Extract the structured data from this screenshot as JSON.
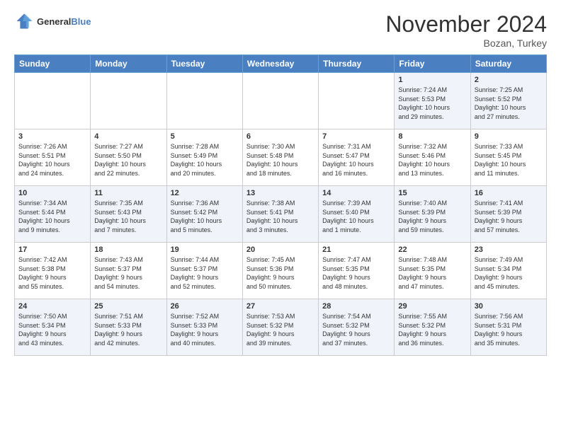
{
  "header": {
    "logo_line1": "General",
    "logo_line2": "Blue",
    "month_title": "November 2024",
    "location": "Bozan, Turkey"
  },
  "days_of_week": [
    "Sunday",
    "Monday",
    "Tuesday",
    "Wednesday",
    "Thursday",
    "Friday",
    "Saturday"
  ],
  "weeks": [
    [
      {
        "day": "",
        "detail": ""
      },
      {
        "day": "",
        "detail": ""
      },
      {
        "day": "",
        "detail": ""
      },
      {
        "day": "",
        "detail": ""
      },
      {
        "day": "",
        "detail": ""
      },
      {
        "day": "1",
        "detail": "Sunrise: 7:24 AM\nSunset: 5:53 PM\nDaylight: 10 hours\nand 29 minutes."
      },
      {
        "day": "2",
        "detail": "Sunrise: 7:25 AM\nSunset: 5:52 PM\nDaylight: 10 hours\nand 27 minutes."
      }
    ],
    [
      {
        "day": "3",
        "detail": "Sunrise: 7:26 AM\nSunset: 5:51 PM\nDaylight: 10 hours\nand 24 minutes."
      },
      {
        "day": "4",
        "detail": "Sunrise: 7:27 AM\nSunset: 5:50 PM\nDaylight: 10 hours\nand 22 minutes."
      },
      {
        "day": "5",
        "detail": "Sunrise: 7:28 AM\nSunset: 5:49 PM\nDaylight: 10 hours\nand 20 minutes."
      },
      {
        "day": "6",
        "detail": "Sunrise: 7:30 AM\nSunset: 5:48 PM\nDaylight: 10 hours\nand 18 minutes."
      },
      {
        "day": "7",
        "detail": "Sunrise: 7:31 AM\nSunset: 5:47 PM\nDaylight: 10 hours\nand 16 minutes."
      },
      {
        "day": "8",
        "detail": "Sunrise: 7:32 AM\nSunset: 5:46 PM\nDaylight: 10 hours\nand 13 minutes."
      },
      {
        "day": "9",
        "detail": "Sunrise: 7:33 AM\nSunset: 5:45 PM\nDaylight: 10 hours\nand 11 minutes."
      }
    ],
    [
      {
        "day": "10",
        "detail": "Sunrise: 7:34 AM\nSunset: 5:44 PM\nDaylight: 10 hours\nand 9 minutes."
      },
      {
        "day": "11",
        "detail": "Sunrise: 7:35 AM\nSunset: 5:43 PM\nDaylight: 10 hours\nand 7 minutes."
      },
      {
        "day": "12",
        "detail": "Sunrise: 7:36 AM\nSunset: 5:42 PM\nDaylight: 10 hours\nand 5 minutes."
      },
      {
        "day": "13",
        "detail": "Sunrise: 7:38 AM\nSunset: 5:41 PM\nDaylight: 10 hours\nand 3 minutes."
      },
      {
        "day": "14",
        "detail": "Sunrise: 7:39 AM\nSunset: 5:40 PM\nDaylight: 10 hours\nand 1 minute."
      },
      {
        "day": "15",
        "detail": "Sunrise: 7:40 AM\nSunset: 5:39 PM\nDaylight: 9 hours\nand 59 minutes."
      },
      {
        "day": "16",
        "detail": "Sunrise: 7:41 AM\nSunset: 5:39 PM\nDaylight: 9 hours\nand 57 minutes."
      }
    ],
    [
      {
        "day": "17",
        "detail": "Sunrise: 7:42 AM\nSunset: 5:38 PM\nDaylight: 9 hours\nand 55 minutes."
      },
      {
        "day": "18",
        "detail": "Sunrise: 7:43 AM\nSunset: 5:37 PM\nDaylight: 9 hours\nand 54 minutes."
      },
      {
        "day": "19",
        "detail": "Sunrise: 7:44 AM\nSunset: 5:37 PM\nDaylight: 9 hours\nand 52 minutes."
      },
      {
        "day": "20",
        "detail": "Sunrise: 7:45 AM\nSunset: 5:36 PM\nDaylight: 9 hours\nand 50 minutes."
      },
      {
        "day": "21",
        "detail": "Sunrise: 7:47 AM\nSunset: 5:35 PM\nDaylight: 9 hours\nand 48 minutes."
      },
      {
        "day": "22",
        "detail": "Sunrise: 7:48 AM\nSunset: 5:35 PM\nDaylight: 9 hours\nand 47 minutes."
      },
      {
        "day": "23",
        "detail": "Sunrise: 7:49 AM\nSunset: 5:34 PM\nDaylight: 9 hours\nand 45 minutes."
      }
    ],
    [
      {
        "day": "24",
        "detail": "Sunrise: 7:50 AM\nSunset: 5:34 PM\nDaylight: 9 hours\nand 43 minutes."
      },
      {
        "day": "25",
        "detail": "Sunrise: 7:51 AM\nSunset: 5:33 PM\nDaylight: 9 hours\nand 42 minutes."
      },
      {
        "day": "26",
        "detail": "Sunrise: 7:52 AM\nSunset: 5:33 PM\nDaylight: 9 hours\nand 40 minutes."
      },
      {
        "day": "27",
        "detail": "Sunrise: 7:53 AM\nSunset: 5:32 PM\nDaylight: 9 hours\nand 39 minutes."
      },
      {
        "day": "28",
        "detail": "Sunrise: 7:54 AM\nSunset: 5:32 PM\nDaylight: 9 hours\nand 37 minutes."
      },
      {
        "day": "29",
        "detail": "Sunrise: 7:55 AM\nSunset: 5:32 PM\nDaylight: 9 hours\nand 36 minutes."
      },
      {
        "day": "30",
        "detail": "Sunrise: 7:56 AM\nSunset: 5:31 PM\nDaylight: 9 hours\nand 35 minutes."
      }
    ]
  ]
}
